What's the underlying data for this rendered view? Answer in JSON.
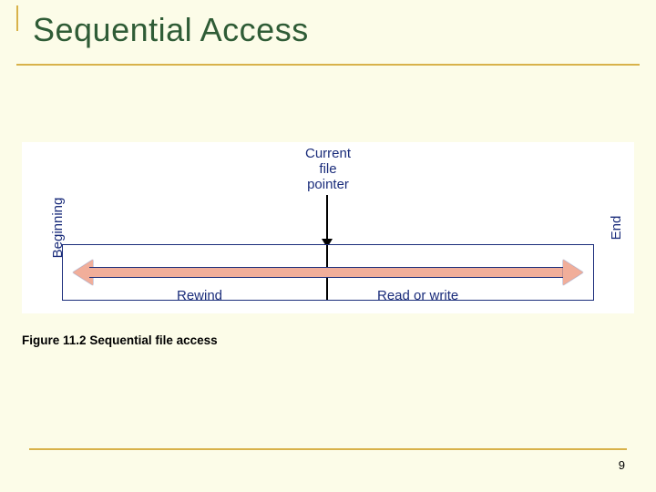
{
  "title": "Sequential Access",
  "labels": {
    "beginning": "Beginning",
    "end": "End",
    "pointer_line1": "Current",
    "pointer_line2": "file",
    "pointer_line3": "pointer",
    "rewind": "Rewind",
    "read_or_write": "Read or write"
  },
  "caption": {
    "fig_number": "Figure 11.2",
    "text": "Sequential file access"
  },
  "page_number": "9"
}
